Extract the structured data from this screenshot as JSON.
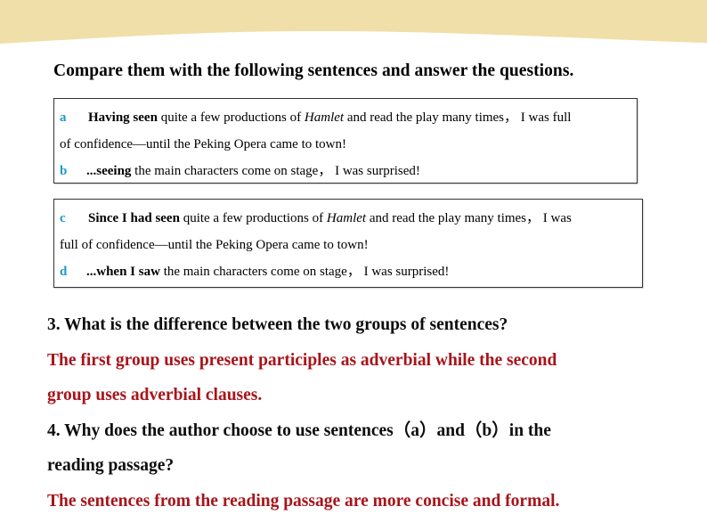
{
  "header": {
    "band_color": "#f0dfa8",
    "mark": "·"
  },
  "title": "Compare them with the following sentences and answer the questions.",
  "colors": {
    "letter": "#1e9bc7",
    "answer": "#a8141b",
    "question": "#0d0d0d"
  },
  "group1": {
    "a": {
      "letter": "a",
      "bold": "Having seen",
      "text1": " quite a few productions of ",
      "italic": "Hamlet",
      "text2": " and read the play many times， I was full",
      "line2": "of confidence—until the Peking Opera came to town!"
    },
    "b": {
      "letter": "b",
      "bold": "...seeing",
      "text": " the main characters come on stage， I was surprised!"
    }
  },
  "group2": {
    "c": {
      "letter": "c",
      "bold": "Since I had seen",
      "text1": " quite a few productions of ",
      "italic": "Hamlet",
      "text2": " and read the play many times， I was",
      "line2": "full of confidence—until the Peking Opera came to town!"
    },
    "d": {
      "letter": "d",
      "bold": "...when I saw",
      "text": " the main characters come on stage， I was surprised!"
    }
  },
  "questions": [
    {
      "question_lines": [
        "3. What is the difference between the two groups of sentences?"
      ],
      "answer_lines": [
        "The first group uses present participles as adverbial while the second",
        "group uses adverbial clauses."
      ]
    },
    {
      "question_lines": [
        "4. Why does the author choose to use sentences（a）and（b）in the",
        "reading passage?"
      ],
      "answer_lines": [
        "The sentences from the reading passage are more concise and formal."
      ]
    }
  ]
}
